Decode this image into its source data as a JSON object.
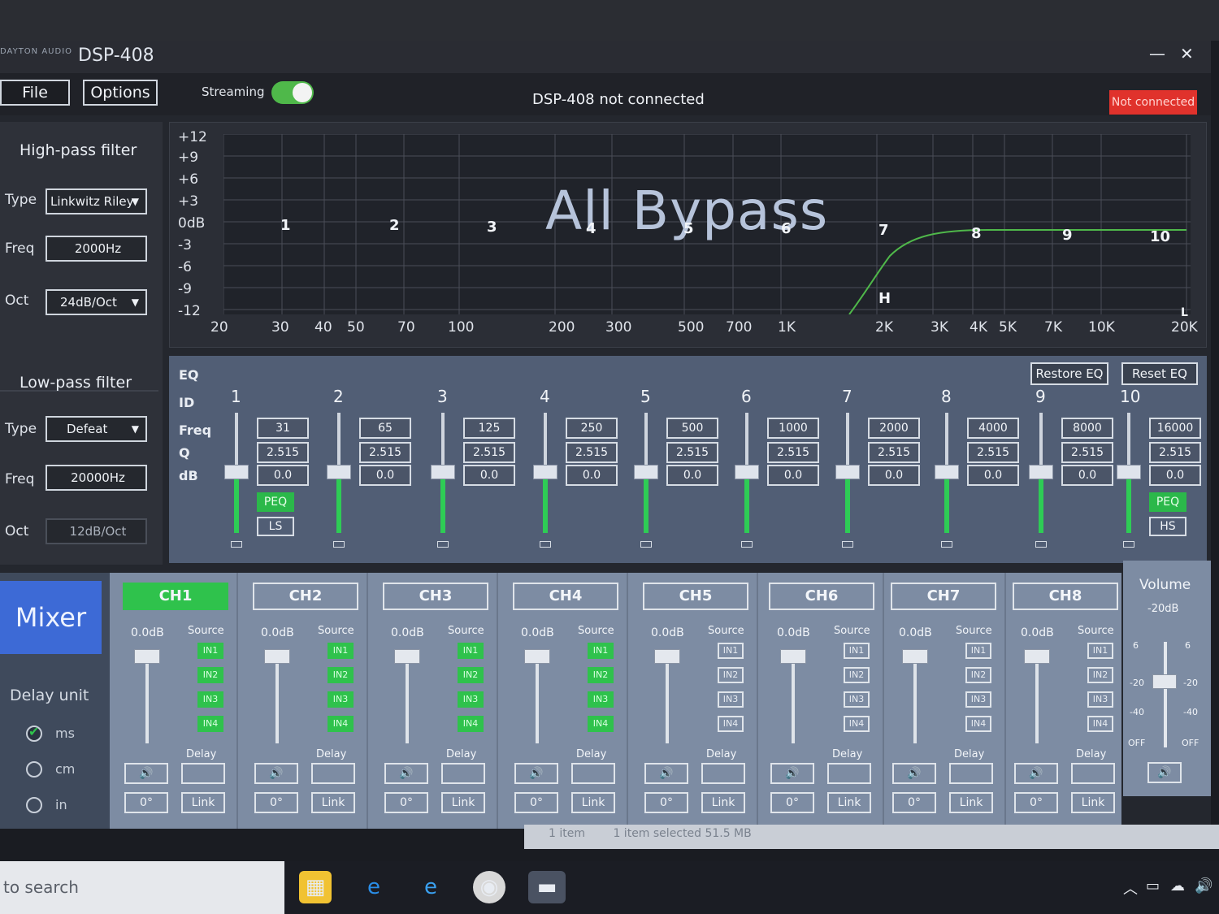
{
  "window": {
    "title": "DSP-408",
    "logo_text": "DAYTON AUDIO",
    "minimize_icon": "—",
    "close_icon": "✕"
  },
  "menu": {
    "file_label": "File",
    "options_label": "Options",
    "streaming_label": "Streaming",
    "streaming_on": true
  },
  "status": {
    "center_text": "DSP-408 not connected",
    "badge_text": "Not connected",
    "badge_color": "#e0322c"
  },
  "highpass": {
    "title": "High-pass filter",
    "type_label": "Type",
    "type_value": "Linkwitz Riley",
    "freq_label": "Freq",
    "freq_value": "2000Hz",
    "oct_label": "Oct",
    "oct_value": "24dB/Oct"
  },
  "lowpass": {
    "title": "Low-pass filter",
    "type_label": "Type",
    "type_value": "Defeat",
    "freq_label": "Freq",
    "freq_value": "20000Hz",
    "oct_label": "Oct",
    "oct_value": "12dB/Oct"
  },
  "graph": {
    "overlay_text": "All Bypass",
    "y_ticks": [
      "+12",
      "+9",
      "+6",
      "+3",
      "0dB",
      "-3",
      "-6",
      "-9",
      "-12"
    ],
    "x_ticks": [
      "20",
      "30",
      "40",
      "50",
      "70",
      "100",
      "200",
      "300",
      "500",
      "700",
      "1K",
      "2K",
      "3K",
      "4K",
      "5K",
      "7K",
      "10K",
      "20K"
    ],
    "band_markers": [
      "1",
      "2",
      "3",
      "4",
      "5",
      "6",
      "7",
      "8",
      "9",
      "10"
    ],
    "hp_marker": "H",
    "lp_marker": "L",
    "curve_color": "#4fb84a"
  },
  "eq": {
    "title": "EQ",
    "id_label": "ID",
    "freq_label": "Freq",
    "q_label": "Q",
    "db_label": "dB",
    "restore_label": "Restore EQ",
    "reset_label": "Reset EQ",
    "bands": [
      {
        "id": "1",
        "freq": "31",
        "q": "2.515",
        "db": "0.0",
        "type_on": "PEQ",
        "type_alt": "LS"
      },
      {
        "id": "2",
        "freq": "65",
        "q": "2.515",
        "db": "0.0"
      },
      {
        "id": "3",
        "freq": "125",
        "q": "2.515",
        "db": "0.0"
      },
      {
        "id": "4",
        "freq": "250",
        "q": "2.515",
        "db": "0.0"
      },
      {
        "id": "5",
        "freq": "500",
        "q": "2.515",
        "db": "0.0"
      },
      {
        "id": "6",
        "freq": "1000",
        "q": "2.515",
        "db": "0.0"
      },
      {
        "id": "7",
        "freq": "2000",
        "q": "2.515",
        "db": "0.0"
      },
      {
        "id": "8",
        "freq": "4000",
        "q": "2.515",
        "db": "0.0"
      },
      {
        "id": "9",
        "freq": "8000",
        "q": "2.515",
        "db": "0.0"
      },
      {
        "id": "10",
        "freq": "16000",
        "q": "2.515",
        "db": "0.0",
        "type_on": "PEQ",
        "type_alt": "HS"
      }
    ]
  },
  "mixer": {
    "title": "Mixer",
    "delay_unit_label": "Delay unit",
    "units": [
      {
        "label": "ms",
        "checked": true
      },
      {
        "label": "cm",
        "checked": false
      },
      {
        "label": "in",
        "checked": false
      }
    ],
    "channels": [
      {
        "name": "CH1",
        "active": true,
        "gain": "0.0dB",
        "source_label": "Source",
        "inputs": [
          {
            "label": "IN1",
            "on": true
          },
          {
            "label": "IN2",
            "on": true
          },
          {
            "label": "IN3",
            "on": true
          },
          {
            "label": "IN4",
            "on": true
          }
        ],
        "delay_label": "Delay",
        "phase": "0°",
        "link": "Link"
      },
      {
        "name": "CH2",
        "active": false,
        "gain": "0.0dB",
        "source_label": "Source",
        "inputs": [
          {
            "label": "IN1",
            "on": true
          },
          {
            "label": "IN2",
            "on": true
          },
          {
            "label": "IN3",
            "on": true
          },
          {
            "label": "IN4",
            "on": true
          }
        ],
        "delay_label": "Delay",
        "phase": "0°",
        "link": "Link"
      },
      {
        "name": "CH3",
        "active": false,
        "gain": "0.0dB",
        "source_label": "Source",
        "inputs": [
          {
            "label": "IN1",
            "on": true
          },
          {
            "label": "IN2",
            "on": true
          },
          {
            "label": "IN3",
            "on": true
          },
          {
            "label": "IN4",
            "on": true
          }
        ],
        "delay_label": "Delay",
        "phase": "0°",
        "link": "Link"
      },
      {
        "name": "CH4",
        "active": false,
        "gain": "0.0dB",
        "source_label": "Source",
        "inputs": [
          {
            "label": "IN1",
            "on": true
          },
          {
            "label": "IN2",
            "on": true
          },
          {
            "label": "IN3",
            "on": true
          },
          {
            "label": "IN4",
            "on": true
          }
        ],
        "delay_label": "Delay",
        "phase": "0°",
        "link": "Link"
      },
      {
        "name": "CH5",
        "active": false,
        "gain": "0.0dB",
        "source_label": "Source",
        "inputs": [
          {
            "label": "IN1",
            "on": false
          },
          {
            "label": "IN2",
            "on": false
          },
          {
            "label": "IN3",
            "on": false
          },
          {
            "label": "IN4",
            "on": false
          }
        ],
        "delay_label": "Delay",
        "phase": "0°",
        "link": "Link"
      },
      {
        "name": "CH6",
        "active": false,
        "gain": "0.0dB",
        "source_label": "Source",
        "inputs": [
          {
            "label": "IN1",
            "on": false
          },
          {
            "label": "IN2",
            "on": false
          },
          {
            "label": "IN3",
            "on": false
          },
          {
            "label": "IN4",
            "on": false
          }
        ],
        "delay_label": "Delay",
        "phase": "0°",
        "link": "Link"
      },
      {
        "name": "CH7",
        "active": false,
        "gain": "0.0dB",
        "source_label": "Source",
        "inputs": [
          {
            "label": "IN1",
            "on": false
          },
          {
            "label": "IN2",
            "on": false
          },
          {
            "label": "IN3",
            "on": false
          },
          {
            "label": "IN4",
            "on": false
          }
        ],
        "delay_label": "Delay",
        "phase": "0°",
        "link": "Link"
      },
      {
        "name": "CH8",
        "active": false,
        "gain": "0.0dB",
        "source_label": "Source",
        "inputs": [
          {
            "label": "IN1",
            "on": false
          },
          {
            "label": "IN2",
            "on": false
          },
          {
            "label": "IN3",
            "on": false
          },
          {
            "label": "IN4",
            "on": false
          }
        ],
        "delay_label": "Delay",
        "phase": "0°",
        "link": "Link"
      }
    ]
  },
  "volume": {
    "title": "Volume",
    "value": "-20dB",
    "ticks": [
      "6",
      "-20",
      "-40",
      "OFF"
    ]
  },
  "statusbar": {
    "items": "1 item",
    "selected": "1 item selected  51.5 MB"
  },
  "taskbar": {
    "search_placeholder": "to search"
  },
  "colors": {
    "accent_green": "#2fc24c",
    "mixer_blue": "#3d6ad6",
    "eq_panel": "#515e75"
  }
}
